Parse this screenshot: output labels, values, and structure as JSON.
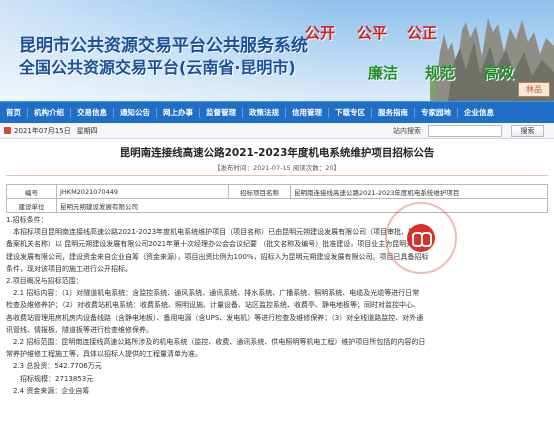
{
  "header": {
    "title_line1": "昆明市公共资源交易平台公共服务系统",
    "title_line2": "全国公共资源交易平台(云南省·昆明市)",
    "slogan_top": [
      "公开",
      "公平",
      "公正"
    ],
    "slogan_bottom": [
      "廉洁",
      "规范",
      "高效"
    ],
    "corner_mark": "林品",
    "colors": {
      "title": "#1a4f9a",
      "red": "#d2221c",
      "green": "#1e8f2b"
    }
  },
  "nav": {
    "items": [
      "首页",
      "机构介绍",
      "交易信息",
      "通知公告",
      "网上办事",
      "监督管理",
      "政策法规",
      "信用管理",
      "下载专区",
      "服务指南",
      "专家园地",
      "企业信息"
    ],
    "background": "#1f6fc8"
  },
  "infobar": {
    "date": "2021年07月15日",
    "weekday": "星期四",
    "search_label": "站内搜索",
    "search_placeholder": "",
    "search_button": "搜索"
  },
  "document": {
    "title": "昆明南连接线高速公路2021-2023年度机电系统维护项目招标公告",
    "meta": "【发布时间：2021-07-15  阅读次数：20】",
    "table": {
      "rows": [
        {
          "label1": "编号",
          "value1": "JHKM2021070449",
          "label2": "招标项目名称",
          "value2": "昆明南连接线高速公路2021-2023年度机电系统维护项目"
        },
        {
          "label1": "建设单位",
          "value1": "昆明元朔建设发展有限公司"
        }
      ]
    },
    "paragraphs": [
      "1.招标条件：",
      "　本招标项目昆明南连接线高速公路2021-2023年度机电系统维护项目（项目名称）已由昆明元朔建设发展有限公司（项目审批、核准或",
      "备案机关名称）以 昆明元朔建设发展有限公司2021年第十次经理办公会会议纪要 （批文名称及编号）批准建设，项目业主为昆明元朔",
      "建设发展有限公司，建设资金来自企业自筹（资金来源），项目出资比例为100%，招标人为昆明元朔建设发展有限公司。项目已具备招标",
      "条件，现对该项目的施工进行公开招标。",
      "2.项目概况与招标范围：",
      "　2.1 招标内容：（1）对隧道机电系统：含监控系统、通风系统、通讯系统、排水系统、广播系统、照明系统、电缆及光缆等进行日常",
      "检查及维修养护；（2）对收费站机电系统：收费系统、照明设施、计量设备、站区监控系统、收费亭、静电地板等；同时对监控中心、",
      "各收费站管理用房机房内设备线路（含静电地板）、备用电源（含UPS、发电机）等进行检查及维修保养；（3）对全线道路监控、对外通",
      "讯管线、情报板、隧道板等进行检查维修保养。",
      "　2.2 招标范围：昆明南连接线高速公路所涉及的机电系统（监控、收费、通讯系统、供电照明等机电工程）维护项目所包括的内容的日",
      "常养护维修工程施工等，具体以招标人提供的工程量清单为准。",
      "　2.3 总投资：542.7706万元",
      "　　招标规模：2713853元",
      "　2.4 资金来源：企业自筹"
    ],
    "seal_text": "昆明元朔建设发展有限公司"
  }
}
